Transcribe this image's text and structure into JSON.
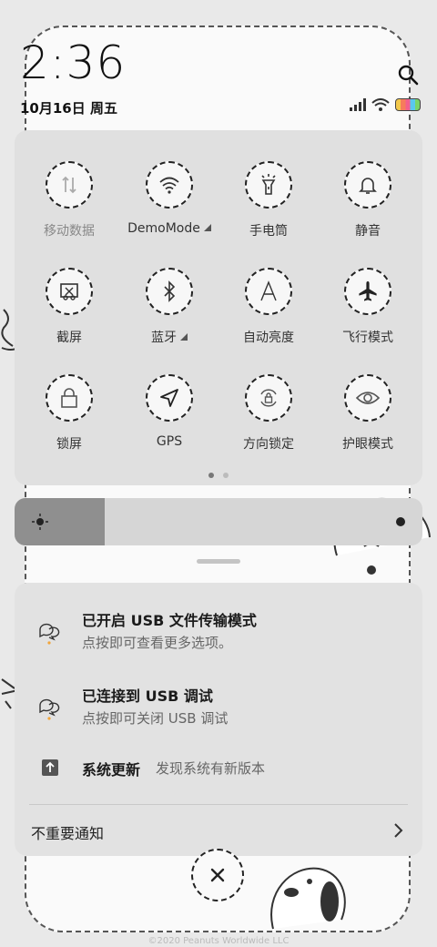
{
  "status_bar": {
    "time": "2:36",
    "date": "10月16日 周五"
  },
  "quick_settings": {
    "tiles": [
      {
        "label": "移动数据",
        "icon": "mobile-data-icon",
        "dim": true
      },
      {
        "label": "DemoMode",
        "icon": "wifi-icon",
        "has_menu": true
      },
      {
        "label": "手电筒",
        "icon": "flashlight-icon"
      },
      {
        "label": "静音",
        "icon": "bell-icon"
      },
      {
        "label": "截屏",
        "icon": "screenshot-icon"
      },
      {
        "label": "蓝牙",
        "icon": "bluetooth-icon",
        "has_menu": true
      },
      {
        "label": "自动亮度",
        "icon": "auto-brightness-icon"
      },
      {
        "label": "飞行模式",
        "icon": "airplane-icon"
      },
      {
        "label": "锁屏",
        "icon": "lock-icon"
      },
      {
        "label": "GPS",
        "icon": "location-arrow-icon"
      },
      {
        "label": "方向锁定",
        "icon": "rotation-lock-icon"
      },
      {
        "label": "护眼模式",
        "icon": "eye-icon"
      }
    ],
    "page_count": 2,
    "active_page": 1
  },
  "brightness": {
    "level": 0.22
  },
  "notifications": [
    {
      "title": "已开启 USB 文件传输模式",
      "text": "点按即可查看更多选项。",
      "icon": "usb-chat-icon"
    },
    {
      "title": "已连接到 USB 调试",
      "text": "点按即可关闭 USB 调试",
      "icon": "usb-chat-icon"
    }
  ],
  "system_update": {
    "title": "系统更新",
    "text": "发现系统有新版本",
    "icon": "upload-icon"
  },
  "unimportant_label": "不重要通知",
  "close_icon": "close-icon",
  "copyright": "©2020 Peanuts Worldwide LLC"
}
